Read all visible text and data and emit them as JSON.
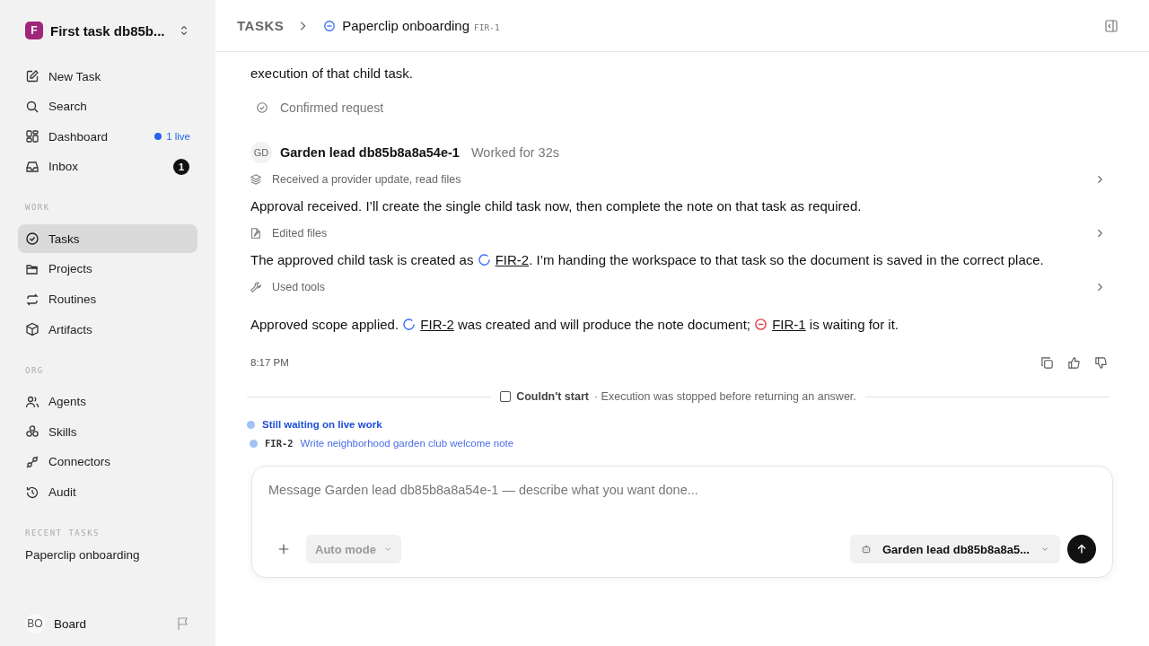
{
  "workspace": {
    "initial": "F",
    "name": "First task db85b..."
  },
  "nav": [
    {
      "label": "New Task"
    },
    {
      "label": "Search"
    },
    {
      "label": "Dashboard",
      "live": "1 live"
    },
    {
      "label": "Inbox",
      "count": "1"
    }
  ],
  "sections": [
    {
      "title": "WORK",
      "items": [
        {
          "label": "Tasks",
          "selected": true
        },
        {
          "label": "Projects",
          "selected": false
        },
        {
          "label": "Routines",
          "selected": false
        },
        {
          "label": "Artifacts",
          "selected": false
        }
      ]
    },
    {
      "title": "ORG",
      "items": [
        {
          "label": "Agents",
          "selected": false
        },
        {
          "label": "Skills",
          "selected": false
        },
        {
          "label": "Connectors",
          "selected": false
        },
        {
          "label": "Audit",
          "selected": false
        }
      ]
    }
  ],
  "recent": {
    "title": "RECENT TASKS",
    "items": [
      "Paperclip onboarding"
    ]
  },
  "user": {
    "initials": "BO",
    "name": "Board"
  },
  "header": {
    "crumb": "TASKS",
    "title": "Paperclip onboarding",
    "code": "FIR-1"
  },
  "feed": [
    {
      "kind": "text",
      "segments": [
        {
          "kind": "text",
          "text": "execution of that child task."
        }
      ]
    },
    {
      "kind": "confirmed",
      "text": "Confirmed request"
    },
    {
      "kind": "author",
      "initials": "GD",
      "name": "Garden lead db85b8a8a54e-1",
      "meta": "Worked for 32s"
    },
    {
      "kind": "activity",
      "text": "Received a provider update, read files"
    },
    {
      "kind": "text",
      "segments": [
        {
          "kind": "text",
          "text": "Approval received. I’ll create the single child task now, then complete the note on that task as required."
        }
      ]
    },
    {
      "kind": "activity",
      "text": "Edited files"
    },
    {
      "kind": "text",
      "segments": [
        {
          "kind": "text",
          "text": "The approved child task is created as "
        },
        {
          "kind": "running_task",
          "code": "FIR-2"
        },
        {
          "kind": "text",
          "text": ". I’m handing the workspace to that task so the document is saved in the correct place."
        }
      ]
    },
    {
      "kind": "activity",
      "text": "Used tools"
    },
    {
      "kind": "summary",
      "segments": [
        {
          "kind": "text",
          "text": "Approved scope applied. "
        },
        {
          "kind": "running_task",
          "code": "FIR-2"
        },
        {
          "kind": "text",
          "text": " was created and will produce the note document; "
        },
        {
          "kind": "blocked_task",
          "code": "FIR-1"
        },
        {
          "kind": "text",
          "text": " is waiting for it."
        }
      ]
    },
    {
      "kind": "footer",
      "time": "8:17 PM"
    }
  ],
  "notice": {
    "status": "Couldn't start",
    "detail": "· Execution was stopped before returning an answer."
  },
  "live": {
    "title": "Still waiting on live work",
    "items": [
      {
        "code": "FIR-2",
        "title": "Write neighborhood garden club welcome note"
      }
    ]
  },
  "composer": {
    "placeholder": "Message Garden lead db85b8a8a54e-1 — describe what you want done...",
    "mode": "Auto mode",
    "agent": "Garden lead db85b8a8a5..."
  }
}
